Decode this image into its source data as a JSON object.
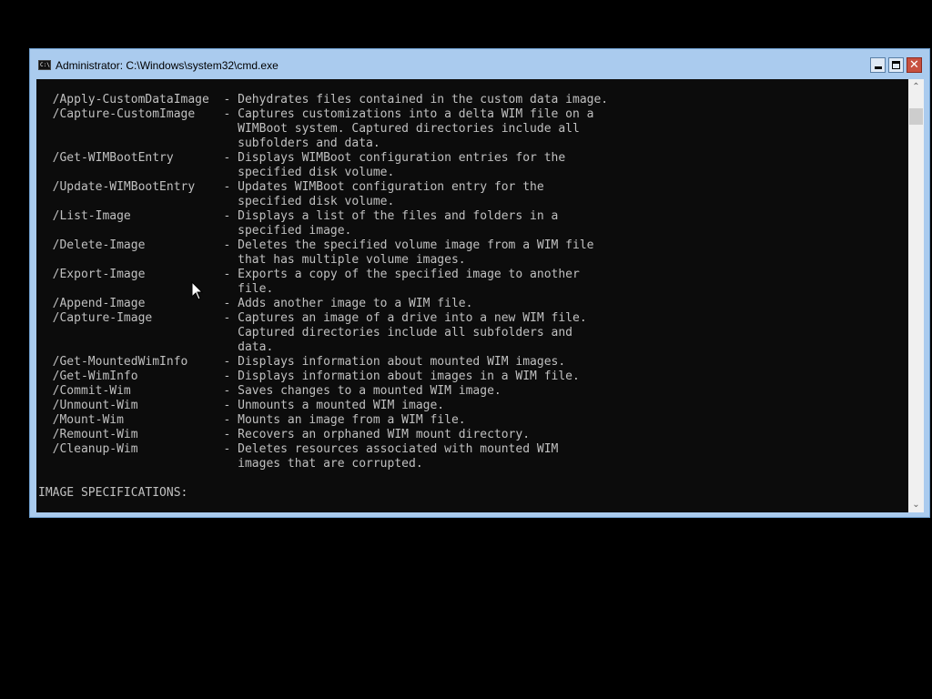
{
  "window": {
    "title": "Administrator: C:\\Windows\\system32\\cmd.exe",
    "icon_text": "C:\\",
    "controls": {
      "minimize": "minimize",
      "maximize": "maximize",
      "close": "✕"
    }
  },
  "console": {
    "lines": [
      "  /Apply-CustomDataImage  - Dehydrates files contained in the custom data image.",
      "  /Capture-CustomImage    - Captures customizations into a delta WIM file on a",
      "                            WIMBoot system. Captured directories include all",
      "                            subfolders and data.",
      "  /Get-WIMBootEntry       - Displays WIMBoot configuration entries for the",
      "                            specified disk volume.",
      "  /Update-WIMBootEntry    - Updates WIMBoot configuration entry for the",
      "                            specified disk volume.",
      "  /List-Image             - Displays a list of the files and folders in a",
      "                            specified image.",
      "  /Delete-Image           - Deletes the specified volume image from a WIM file",
      "                            that has multiple volume images.",
      "  /Export-Image           - Exports a copy of the specified image to another",
      "                            file.",
      "  /Append-Image           - Adds another image to a WIM file.",
      "  /Capture-Image          - Captures an image of a drive into a new WIM file.",
      "                            Captured directories include all subfolders and",
      "                            data.",
      "  /Get-MountedWimInfo     - Displays information about mounted WIM images.",
      "  /Get-WimInfo            - Displays information about images in a WIM file.",
      "  /Commit-Wim             - Saves changes to a mounted WIM image.",
      "  /Unmount-Wim            - Unmounts a mounted WIM image.",
      "  /Mount-Wim              - Mounts an image from a WIM file.",
      "  /Remount-Wim            - Recovers an orphaned WIM mount directory.",
      "  /Cleanup-Wim            - Deletes resources associated with mounted WIM",
      "                            images that are corrupted.",
      "",
      "IMAGE SPECIFICATIONS:"
    ]
  },
  "scrollbar": {
    "up_arrow": "⌃",
    "down_arrow": "⌄"
  },
  "colors": {
    "window_frame": "#aacbee",
    "console_bg": "#0c0c0c",
    "console_text": "#c0c0c0",
    "close_button": "#c7503f"
  }
}
